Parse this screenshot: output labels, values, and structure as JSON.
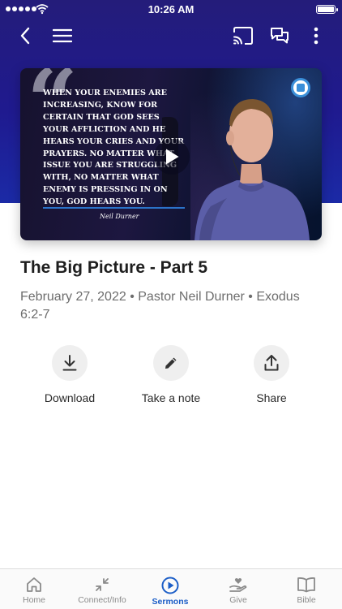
{
  "status_bar": {
    "time": "10:26 AM"
  },
  "video": {
    "quote": "When your enemies are increasing, know for certain that God sees your affliction and he hears your cries and your prayers. No matter what issue you are struggling with, no matter what enemy is pressing in on you, God hears you.",
    "signature": "Neil Durner"
  },
  "sermon": {
    "title": "The Big Picture - Part 5",
    "meta": "February 27, 2022 • Pastor Neil Durner • Exodus 6:2-7"
  },
  "actions": [
    {
      "label": "Download",
      "icon": "download-icon"
    },
    {
      "label": "Take a note",
      "icon": "pencil-icon"
    },
    {
      "label": "Share",
      "icon": "share-icon"
    }
  ],
  "tabs": [
    {
      "label": "Home",
      "icon": "home-icon",
      "active": false
    },
    {
      "label": "Connect/Info",
      "icon": "connect-icon",
      "active": false
    },
    {
      "label": "Sermons",
      "icon": "play-circle-icon",
      "active": true
    },
    {
      "label": "Give",
      "icon": "give-hand-icon",
      "active": false
    },
    {
      "label": "Bible",
      "icon": "book-icon",
      "active": false
    }
  ],
  "colors": {
    "header": "#1f1a8f",
    "accent": "#1c5ec7",
    "tab_inactive": "#8a8a8a"
  }
}
